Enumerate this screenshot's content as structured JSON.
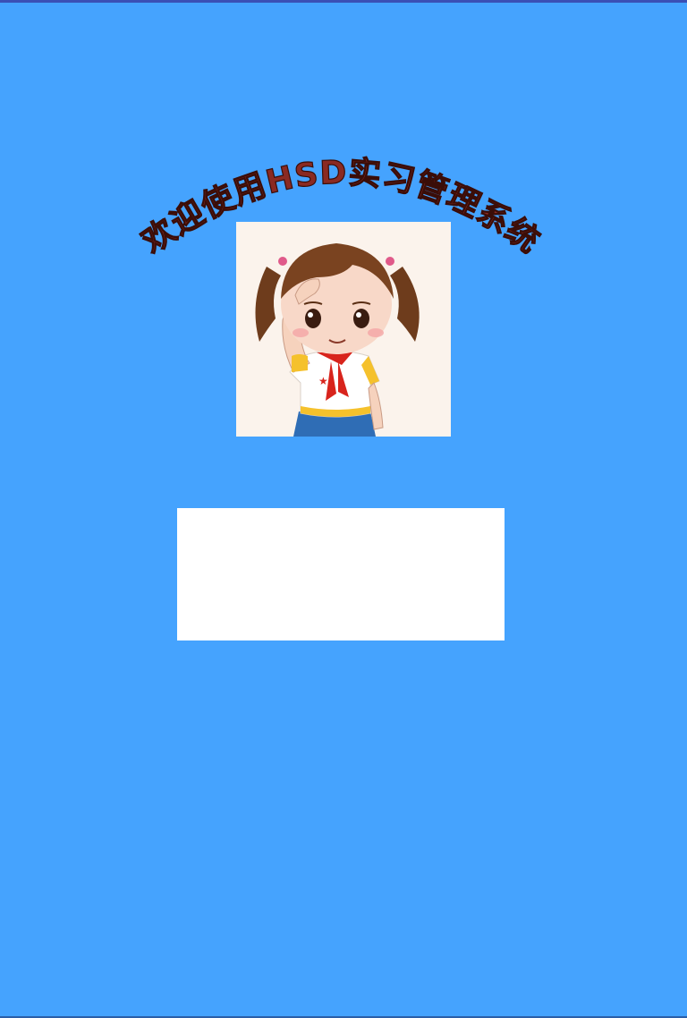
{
  "app": {
    "welcome_text": "欢迎使用HSD实习管理系统"
  },
  "colors": {
    "background": "#45a3fe",
    "title_fill": "#8a2a22",
    "panel": "#ffffff"
  },
  "avatar": {
    "icon": "cartoon-girl-saluting"
  }
}
